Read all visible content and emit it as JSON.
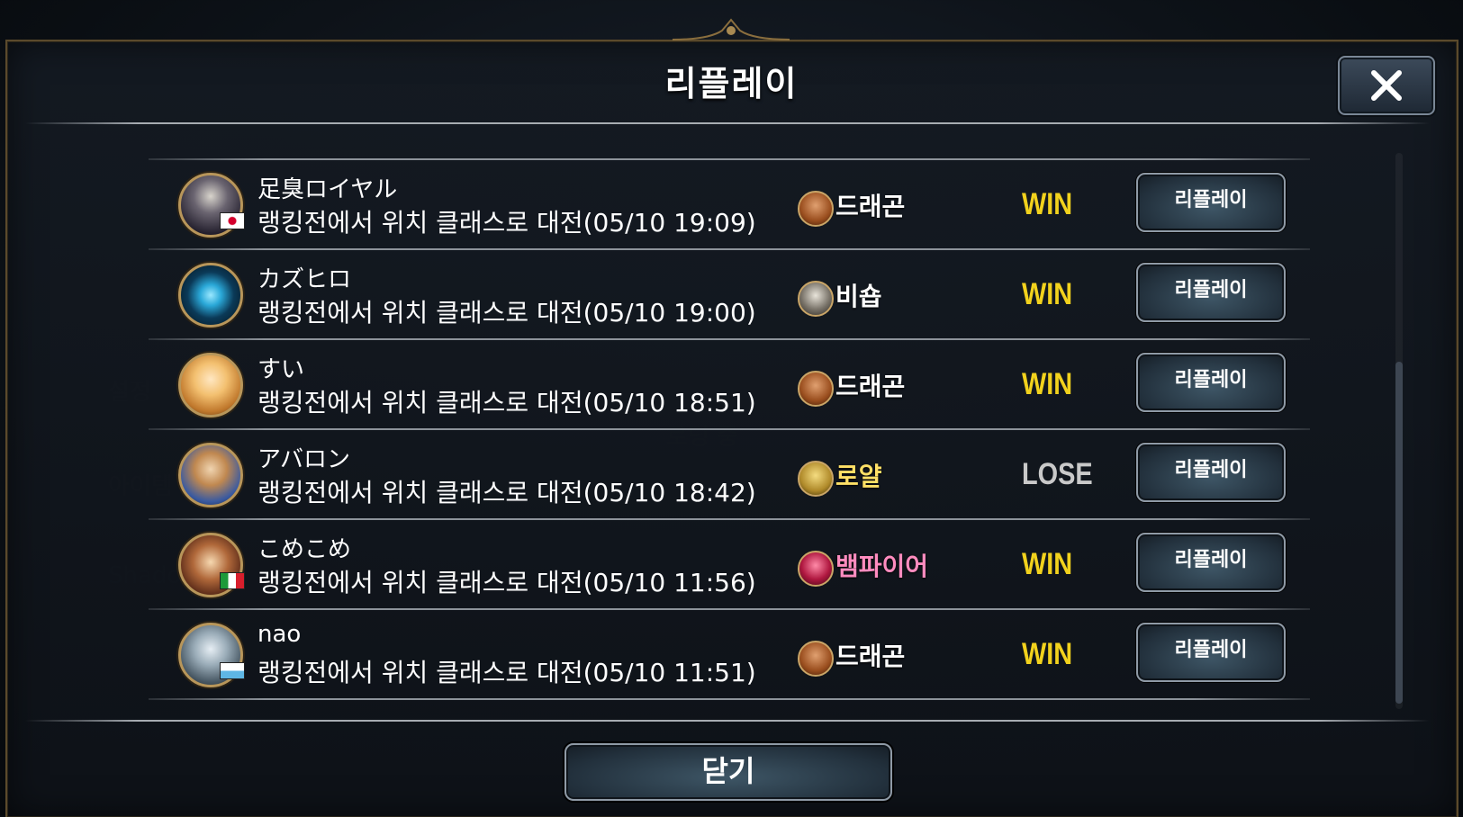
{
  "dialog": {
    "title": "리플레이",
    "close_label": "닫기"
  },
  "colors": {
    "win": "#f2d21d",
    "lose": "#c9c9c9",
    "dragon": "#ffffff",
    "vampire": "#ff8cbf",
    "royal": "#ffe066",
    "bishop": "#ffffff"
  },
  "matches": [
    {
      "name": "足臭ロイヤル",
      "description": "랭킹전에서 위치 클래스로 대전(05/10 19:09)",
      "class": "드래곤",
      "class_icon": "dragon-icon",
      "result": "WIN",
      "flag": "japan",
      "button": "리플레이"
    },
    {
      "name": "カズヒロ",
      "description": "랭킹전에서 위치 클래스로 대전(05/10 19:00)",
      "class": "비숍",
      "class_icon": "bishop-icon",
      "result": "WIN",
      "flag": "",
      "button": "리플레이"
    },
    {
      "name": "すい",
      "description": "랭킹전에서 위치 클래스로 대전(05/10 18:51)",
      "class": "드래곤",
      "class_icon": "dragon-icon",
      "result": "WIN",
      "flag": "",
      "button": "리플레이"
    },
    {
      "name": "アバロン",
      "description": "랭킹전에서 위치 클래스로 대전(05/10 18:42)",
      "class": "로얄",
      "class_icon": "royal-icon",
      "result": "LOSE",
      "flag": "",
      "button": "리플레이"
    },
    {
      "name": "こめこめ",
      "description": "랭킹전에서 위치 클래스로 대전(05/10 11:56)",
      "class": "뱀파이어",
      "class_icon": "vampire-icon",
      "result": "WIN",
      "flag": "italy",
      "button": "리플레이"
    },
    {
      "name": "nao",
      "description": "랭킹전에서 위치 클래스로 대전(05/10 11:51)",
      "class": "드래곤",
      "class_icon": "dragon-icon",
      "result": "WIN",
      "flag": "san-marino",
      "button": "리플레이"
    }
  ]
}
